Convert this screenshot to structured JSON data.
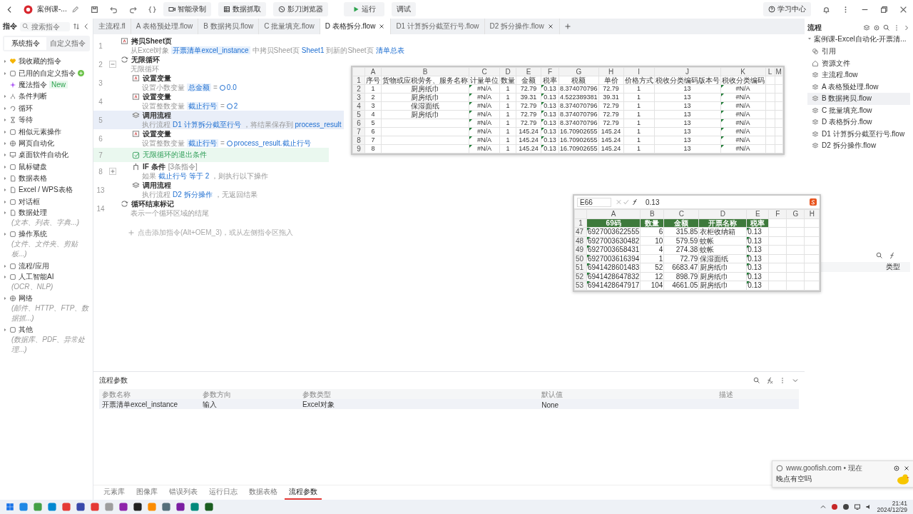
{
  "titlebar": {
    "title": "案例课-...",
    "tools": [
      {
        "label": "智能录制",
        "kind": "record"
      },
      {
        "label": "数据抓取",
        "kind": "grab"
      },
      {
        "label": "影刀浏览器",
        "kind": "browser"
      }
    ],
    "run": "运行",
    "debug": "调试",
    "help": "学习中心"
  },
  "sidebar": {
    "title": "指令",
    "search": {
      "placeholder": "搜索指令"
    },
    "tabs": [
      {
        "label": "系统指令",
        "selected": true
      },
      {
        "label": "自定义指令",
        "selected": false
      }
    ],
    "items": [
      {
        "label": "我收藏的指令",
        "kind": "group"
      },
      {
        "label": "已用的自定义指令",
        "kind": "group",
        "indicator": true
      },
      {
        "label": "魔法指令",
        "kind": "leaf",
        "badge": "New"
      },
      {
        "label": "条件判断",
        "kind": "group"
      },
      {
        "label": "循环",
        "kind": "group"
      },
      {
        "label": "等待",
        "kind": "group"
      },
      {
        "label": "相似元素操作",
        "kind": "group"
      },
      {
        "label": "网页自动化",
        "kind": "group"
      },
      {
        "label": "桌面软件自动化",
        "kind": "group"
      },
      {
        "label": "鼠标键盘",
        "kind": "group"
      },
      {
        "label": "数据表格",
        "kind": "group"
      },
      {
        "label": "Excel / WPS表格",
        "kind": "group"
      },
      {
        "label": "对话框",
        "kind": "group"
      },
      {
        "label": "数据处理",
        "kind": "group",
        "hint": "(文本、列表、字典...)"
      },
      {
        "label": "操作系统",
        "kind": "group",
        "hint": "(文件、文件夹、剪贴板...)"
      },
      {
        "label": "流程/应用",
        "kind": "group"
      },
      {
        "label": "人工智能AI",
        "kind": "group",
        "hint": "(OCR、NLP)"
      },
      {
        "label": "网络",
        "kind": "group",
        "hint": "(邮件、HTTP、FTP、数据抓...)"
      },
      {
        "label": "其他",
        "kind": "group",
        "hint": "(数据库、PDF、异常处理...)"
      }
    ]
  },
  "flow_tabs": [
    {
      "label": "主流程.fl",
      "selected": false,
      "closable": false
    },
    {
      "label": "A 表格预处理.flow",
      "selected": false,
      "closable": false
    },
    {
      "label": "B 数据拷贝.flow",
      "selected": false,
      "closable": false
    },
    {
      "label": "C 批量填充.flow",
      "selected": false,
      "closable": false
    },
    {
      "label": "D 表格拆分.flow",
      "selected": true,
      "closable": true
    },
    {
      "label": "D1 计算拆分截至行号.flow",
      "selected": false,
      "closable": false
    },
    {
      "label": "D2 拆分操作.flow",
      "selected": false,
      "closable": true
    }
  ],
  "flow": {
    "steps": [
      {
        "line": "1",
        "kind": "action",
        "title": "拷贝Sheet页",
        "selected": false,
        "desc": [
          {
            "text": "从Excel对象",
            "kind": "plain"
          },
          {
            "text": "开票清单excel_instance",
            "kind": "token"
          },
          {
            "text": "中拷贝Sheet页",
            "kind": "plain"
          },
          {
            "text": "Sheet1",
            "kind": "link"
          },
          {
            "text": "到新的Sheet页",
            "kind": "plain"
          },
          {
            "text": "清单总表",
            "kind": "link"
          }
        ]
      },
      {
        "line": "2",
        "kind": "loop",
        "title": "无限循环",
        "selected": false,
        "expanded": true,
        "desc": [
          {
            "text": "无限循环",
            "kind": "plain"
          }
        ],
        "children": [
          {
            "line": "3",
            "kind": "action",
            "title": "设置变量",
            "selected": false,
            "desc": [
              {
                "text": "设置小数变量",
                "kind": "plain"
              },
              {
                "text": "总金额",
                "kind": "token"
              },
              {
                "text": "=",
                "kind": "plain"
              },
              {
                "text": "0.0",
                "kind": "value"
              }
            ]
          },
          {
            "line": "4",
            "kind": "action",
            "title": "设置变量",
            "selected": false,
            "desc": [
              {
                "text": "设置整数变量",
                "kind": "plain"
              },
              {
                "text": "截止行号",
                "kind": "token"
              },
              {
                "text": "=",
                "kind": "plain"
              },
              {
                "text": "2",
                "kind": "value"
              }
            ]
          },
          {
            "line": "5",
            "kind": "call",
            "title": "调用流程",
            "selected": true,
            "desc": [
              {
                "text": "执行流程",
                "kind": "plain"
              },
              {
                "text": "D1 计算拆分截至行号",
                "kind": "link"
              },
              {
                "text": "，将结果保存到",
                "kind": "plain"
              },
              {
                "text": "process_result",
                "kind": "link"
              }
            ]
          },
          {
            "line": "6",
            "kind": "action",
            "title": "设置变量",
            "selected": false,
            "desc": [
              {
                "text": "设置整数变量",
                "kind": "plain"
              },
              {
                "text": "截止行号",
                "kind": "token"
              },
              {
                "text": "=",
                "kind": "plain"
              },
              {
                "text": "process_result.截止行号",
                "kind": "value"
              }
            ]
          },
          {
            "line": "7",
            "kind": "exit",
            "title": "无限循环的退出条件",
            "selected": false
          },
          {
            "line": "8",
            "kind": "if",
            "title": "IF 条件",
            "count": "[3条指令]",
            "selected": false,
            "expanded": false,
            "desc": [
              {
                "text": "如果",
                "kind": "plain"
              },
              {
                "text": "截止行号",
                "kind": "link"
              },
              {
                "text": "等于 2",
                "kind": "link"
              },
              {
                "text": "，则执行以下操作",
                "kind": "plain"
              }
            ]
          },
          {
            "line": "13",
            "kind": "call",
            "title": "调用流程",
            "selected": false,
            "desc": [
              {
                "text": "执行流程",
                "kind": "plain"
              },
              {
                "text": "D2 拆分操作",
                "kind": "link"
              },
              {
                "text": "，无返回结果",
                "kind": "plain"
              }
            ]
          }
        ]
      },
      {
        "line": "14",
        "kind": "loop",
        "title": "循环结束标记",
        "selected": false,
        "desc": [
          {
            "text": "表示一个循环区域的结尾",
            "kind": "plain"
          }
        ]
      }
    ],
    "add_hint": "点击添加指令(Alt+OEM_3)，或从左侧指令区拖入"
  },
  "excel_1": {
    "columns": [
      {
        "letter": "A",
        "flagged": false
      },
      {
        "letter": "B",
        "flagged": false
      },
      {
        "letter": "C",
        "flagged": true
      },
      {
        "letter": "D",
        "flagged": false
      },
      {
        "letter": "E",
        "flagged": false
      },
      {
        "letter": "F",
        "flagged": true
      },
      {
        "letter": "G",
        "flagged": false
      },
      {
        "letter": "H",
        "flagged": false
      },
      {
        "letter": "I",
        "flagged": false
      },
      {
        "letter": "J",
        "flagged": false
      },
      {
        "letter": "K",
        "flagged": true
      },
      {
        "letter": "L",
        "flagged": false
      },
      {
        "letter": "M",
        "flagged": false
      }
    ],
    "rows": [
      {
        "header": "1",
        "kind": "header",
        "cells": {
          "A": "序号",
          "B": "货物或应税劳务、服务名称",
          "C": "计量单位",
          "D": "数量",
          "E": "金额",
          "F": "税率",
          "G": "税额",
          "H": "单价",
          "I": "价格方式",
          "J": "税收分类编码版本号",
          "K": "税收分类编码"
        }
      },
      {
        "header": "2",
        "kind": "data",
        "cells": {
          "A": "1",
          "B": "厨房纸巾",
          "C": "#N/A",
          "D": "1",
          "E": "72.79",
          "F": "0.13",
          "G": "8.374070796",
          "H": "72.79",
          "I": "1",
          "J": "13",
          "K": "#N/A"
        }
      },
      {
        "header": "3",
        "kind": "data",
        "cells": {
          "A": "2",
          "B": "厨房纸巾",
          "C": "#N/A",
          "D": "1",
          "E": "39.31",
          "F": "0.13",
          "G": "4.522389381",
          "H": "39.31",
          "I": "1",
          "J": "13",
          "K": "#N/A"
        }
      },
      {
        "header": "4",
        "kind": "data",
        "cells": {
          "A": "3",
          "B": "保湿面纸",
          "C": "#N/A",
          "D": "1",
          "E": "72.79",
          "F": "0.13",
          "G": "8.374070796",
          "H": "72.79",
          "I": "1",
          "J": "13",
          "K": "#N/A"
        }
      },
      {
        "header": "5",
        "kind": "data",
        "cells": {
          "A": "4",
          "B": "厨房纸巾",
          "C": "#N/A",
          "D": "1",
          "E": "72.79",
          "F": "0.13",
          "G": "8.374070796",
          "H": "72.79",
          "I": "1",
          "J": "13",
          "K": "#N/A"
        }
      },
      {
        "header": "6",
        "kind": "data",
        "cells": {
          "A": "5",
          "C": "#N/A",
          "D": "1",
          "E": "72.79",
          "F": "0.13",
          "G": "8.374070796",
          "H": "72.79",
          "I": "1",
          "J": "13",
          "K": "#N/A"
        }
      },
      {
        "header": "7",
        "kind": "data",
        "cells": {
          "A": "6",
          "C": "#N/A",
          "D": "1",
          "E": "145.24",
          "F": "0.13",
          "G": "16.70902655",
          "H": "145.24",
          "I": "1",
          "J": "13",
          "K": "#N/A"
        }
      },
      {
        "header": "8",
        "kind": "data",
        "cells": {
          "A": "7",
          "C": "#N/A",
          "D": "1",
          "E": "145.24",
          "F": "0.13",
          "G": "16.70902655",
          "H": "145.24",
          "I": "1",
          "J": "13",
          "K": "#N/A"
        }
      },
      {
        "header": "9",
        "kind": "data",
        "cells": {
          "A": "8",
          "C": "#N/A",
          "D": "1",
          "E": "145.24",
          "F": "0.13",
          "G": "16.70902655",
          "H": "145.24",
          "I": "1",
          "J": "13",
          "K": "#N/A"
        }
      }
    ]
  },
  "excel_2": {
    "name_box": "E66",
    "formula": "0.13",
    "columns": [
      {
        "letter": "A",
        "flagged": true
      },
      {
        "letter": "B",
        "flagged": false
      },
      {
        "letter": "C",
        "flagged": false
      },
      {
        "letter": "D",
        "flagged": false
      },
      {
        "letter": "E",
        "flagged": true
      },
      {
        "letter": "F",
        "flagged": false
      },
      {
        "letter": "G",
        "flagged": false
      },
      {
        "letter": "H",
        "flagged": false
      }
    ],
    "rows": [
      {
        "header": "1",
        "kind": "header",
        "cells": {
          "A": "69码",
          "B": "数量",
          "C": "金额",
          "D": "开票名称",
          "E": "税率"
        }
      },
      {
        "header": "47",
        "kind": "data",
        "cells": {
          "A": "6927003622555",
          "B": "6",
          "C": "315.85",
          "D": "衣柜收纳箱",
          "E": "0.13"
        }
      },
      {
        "header": "48",
        "kind": "data",
        "cells": {
          "A": "6927003630482",
          "B": "10",
          "C": "579.59",
          "D": "蚊帐",
          "E": "0.13"
        }
      },
      {
        "header": "49",
        "kind": "data",
        "cells": {
          "A": "6927003658431",
          "B": "4",
          "C": "274.38",
          "D": "蚊帐",
          "E": "0.13"
        }
      },
      {
        "header": "50",
        "kind": "data",
        "cells": {
          "A": "6927003616394",
          "B": "1",
          "C": "72.79",
          "D": "保湿面纸",
          "E": "0.13"
        }
      },
      {
        "header": "51",
        "kind": "data",
        "cells": {
          "A": "6941428601483",
          "B": "52",
          "C": "6683.47",
          "D": "厨房纸巾",
          "E": "0.13"
        }
      },
      {
        "header": "52",
        "kind": "data",
        "cells": {
          "A": "6941428647832",
          "B": "12",
          "C": "898.79",
          "D": "厨房纸巾",
          "E": "0.13"
        }
      },
      {
        "header": "53",
        "kind": "data",
        "cells": {
          "A": "6941428647917",
          "B": "104",
          "C": "4661.05",
          "D": "厨房纸巾",
          "E": "0.13"
        }
      }
    ]
  },
  "params": {
    "title": "流程参数",
    "columns": [
      "参数名称",
      "参数方向",
      "参数类型",
      "默认值",
      "描述"
    ],
    "rows": [
      [
        "开票清单excel_instance",
        "输入",
        "Excel对象",
        "None"
      ]
    ]
  },
  "bottom_tabs": [
    {
      "label": "元素库",
      "selected": false
    },
    {
      "label": "图像库",
      "selected": false
    },
    {
      "label": "错误列表",
      "selected": false
    },
    {
      "label": "运行日志",
      "selected": false
    },
    {
      "label": "数据表格",
      "selected": false
    },
    {
      "label": "流程参数",
      "selected": true
    }
  ],
  "project": {
    "title": "流程",
    "name": "案例课-Excel自动化-开票清...",
    "expanded": true,
    "items": [
      {
        "label": "引用",
        "kind": "ref",
        "selected": false
      },
      {
        "label": "资源文件",
        "kind": "resource",
        "selected": false
      },
      {
        "label": "主流程.flow",
        "kind": "flow",
        "selected": false
      },
      {
        "label": "A 表格预处理.flow",
        "kind": "flow",
        "selected": false
      },
      {
        "label": "B 数据拷贝.flow",
        "kind": "flow",
        "selected": true
      },
      {
        "label": "C 批量填充.flow",
        "kind": "flow",
        "selected": false
      },
      {
        "label": "D 表格拆分.flow",
        "kind": "flow",
        "selected": false
      },
      {
        "label": "D1 计算拆分截至行号.flow",
        "kind": "flow",
        "selected": false
      },
      {
        "label": "D2 拆分操作.flow",
        "kind": "flow",
        "selected": false
      }
    ],
    "lower_column": "类型"
  },
  "notification": {
    "source": "www.goofish.com • 现在",
    "message": "晚点有空吗"
  },
  "taskbar": {
    "time": "21:41",
    "date": "2024/12/29"
  }
}
